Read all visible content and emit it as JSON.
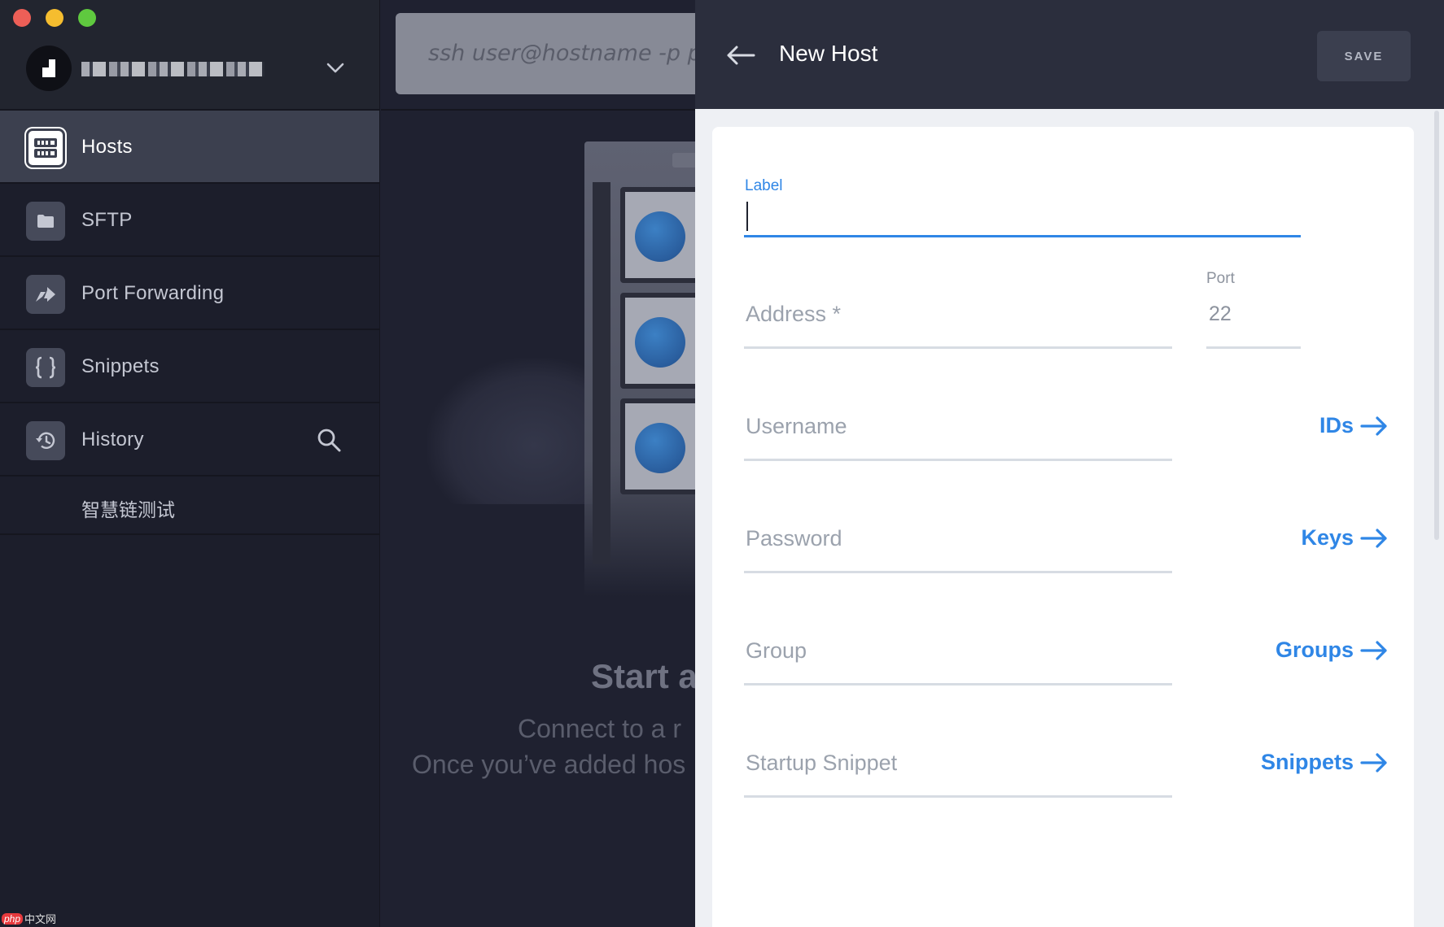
{
  "window": {
    "traffic_lights": [
      "close",
      "minimize",
      "zoom"
    ]
  },
  "sidebar": {
    "account_name": "",
    "items": [
      {
        "label": "Hosts",
        "icon": "server-icon",
        "active": true
      },
      {
        "label": "SFTP",
        "icon": "folder-icon",
        "active": false
      },
      {
        "label": "Port Forwarding",
        "icon": "port-forwarding-icon",
        "active": false
      },
      {
        "label": "Snippets",
        "icon": "braces-icon",
        "active": false
      },
      {
        "label": "History",
        "icon": "history-icon",
        "active": false
      }
    ],
    "history_entries": [
      "智慧链测试"
    ]
  },
  "main": {
    "quick_connect_placeholder": "ssh user@hostname -p port",
    "empty_title": "Start a",
    "empty_line1": "Connect to a r",
    "empty_line2": "Once you’ve added hos"
  },
  "panel": {
    "title": "New Host",
    "save_label": "SAVE",
    "fields": {
      "label": {
        "label": "Label",
        "value": ""
      },
      "address": {
        "placeholder": "Address *"
      },
      "port": {
        "label": "Port",
        "value": "22"
      },
      "username": {
        "placeholder": "Username",
        "link": "IDs"
      },
      "password": {
        "placeholder": "Password",
        "link": "Keys"
      },
      "group": {
        "placeholder": "Group",
        "link": "Groups"
      },
      "startup_snippet": {
        "placeholder": "Startup Snippet",
        "link": "Snippets"
      }
    }
  },
  "watermark": {
    "brand": "php",
    "text": "中文网"
  },
  "colors": {
    "accent": "#2f86e6",
    "sidebar_bg": "#1c1e2b",
    "header_bg": "#2b2e3d",
    "active_item_bg": "#3c404f"
  }
}
